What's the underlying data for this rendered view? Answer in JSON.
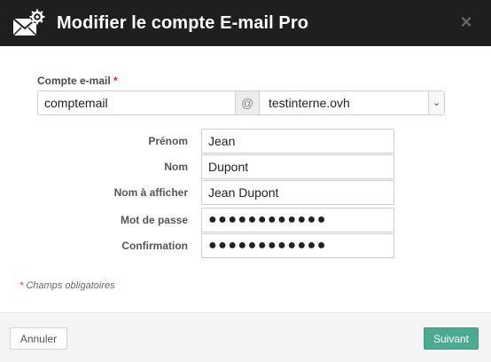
{
  "dialog": {
    "title": "Modifier le compte E-mail Pro",
    "close_symbol": "×",
    "header_icon": "envelope-gear-icon"
  },
  "account": {
    "label": "Compte e-mail",
    "required_marker": "*",
    "local_part": "comptemail",
    "at_symbol": "@",
    "domain": "testinterne.ovh",
    "domain_arrow": "⌄"
  },
  "fields": {
    "first_name": {
      "label": "Prénom",
      "value": "Jean"
    },
    "last_name": {
      "label": "Nom",
      "value": "Dupont"
    },
    "display_name": {
      "label": "Nom à afficher",
      "value": "Jean Dupont"
    },
    "password": {
      "label": "Mot de passe",
      "value": "●●●●●●●●●●●●"
    },
    "confirmation": {
      "label": "Confirmation",
      "value": "●●●●●●●●●●●●"
    }
  },
  "note": {
    "star": "*",
    "text": "Champs obligatoires"
  },
  "footer": {
    "cancel_label": "Annuler",
    "next_label": "Suivant"
  },
  "colors": {
    "header_bg": "#1f1f1f",
    "required": "#d9262e",
    "primary_button": "#4aab92"
  }
}
